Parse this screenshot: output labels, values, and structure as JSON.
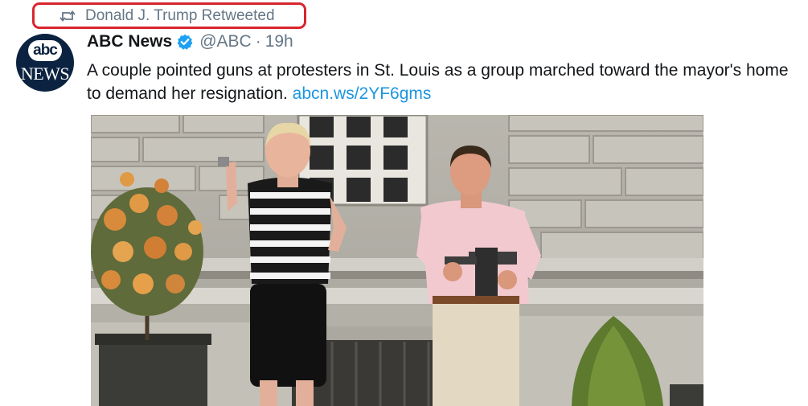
{
  "retweet": {
    "text": "Donald J. Trump Retweeted"
  },
  "account": {
    "avatar_top": "abc",
    "avatar_bottom": "NEWS",
    "name": "ABC News",
    "handle": "@ABC",
    "separator": "·",
    "time": "19h"
  },
  "tweet": {
    "text": "A couple pointed guns at protesters in St. Louis as a group marched toward the mayor's home to demand her resignation. ",
    "link": "abcn.ws/2YF6gms"
  },
  "colors": {
    "link": "#1b95e0",
    "muted": "#657786",
    "highlight_border": "#d7262e",
    "verified": "#1da1f2"
  },
  "icons": [
    "retweet-icon",
    "verified-icon"
  ]
}
